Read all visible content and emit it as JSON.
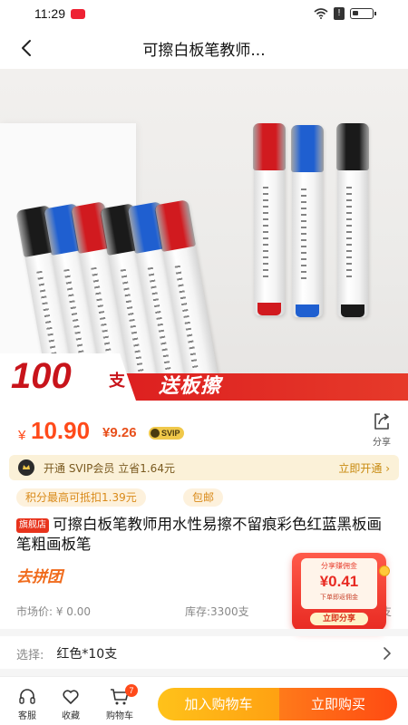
{
  "status_bar": {
    "time": "11:29",
    "battery_level": 0.3
  },
  "header": {
    "title": "可擦白板笔教师..."
  },
  "hero": {
    "promo_qty": "100",
    "promo_unit": "支",
    "promo_gift": "送板擦",
    "pen_colors": [
      "#1a1a1a",
      "#1f5fd0",
      "#d11a1f",
      "#1a1a1a",
      "#1f5fd0",
      "#d11a1f",
      "#d11a1f",
      "#1f5fd0",
      "#1a1a1a"
    ]
  },
  "price": {
    "currency": "¥",
    "main": "10.90",
    "svip_price": "¥9.26",
    "svip_tag": "SVIP",
    "share_label": "分享"
  },
  "svip_banner": {
    "text": "开通 SVIP会员 立省1.64元",
    "action": "立即开通 ›"
  },
  "tags": [
    "积分最高可抵扣1.39元",
    "包邮"
  ],
  "product": {
    "store_badge": "旗舰店",
    "title": "可擦白板笔教师用水性易擦不留痕彩色红蓝黑板画笔粗画板笔",
    "group_buy": "去拼团",
    "market_price": "市场价: ¥ 0.00",
    "stock": "库存:3300支",
    "extra": "支"
  },
  "commission": {
    "top": "分享赚佣金",
    "amount": "¥0.41",
    "sub": "下单即返佣金",
    "button": "立即分享"
  },
  "option": {
    "label": "选择:",
    "value": "红色*10支"
  },
  "bottom_bar": {
    "service": "客服",
    "favorite": "收藏",
    "cart": "购物车",
    "cart_count": "7",
    "add_to_cart": "加入购物车",
    "buy_now": "立即购买"
  },
  "colors": {
    "accent": "#ff4a1a",
    "svip_gold": "#f0c84a",
    "cart_yellow": "#ffb016"
  }
}
